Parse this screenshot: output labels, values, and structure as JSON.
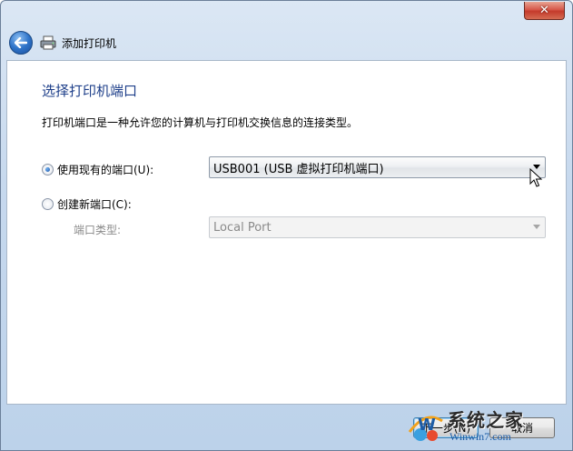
{
  "window": {
    "close_label": "✕"
  },
  "nav": {
    "title": "添加打印机"
  },
  "page": {
    "title": "选择打印机端口",
    "description": "打印机端口是一种允许您的计算机与打印机交换信息的连接类型。"
  },
  "options": {
    "existing_port": {
      "label": "使用现有的端口(U):",
      "checked": true,
      "selected_value": "USB001 (USB 虚拟打印机端口)"
    },
    "new_port": {
      "label": "创建新端口(C):",
      "checked": false,
      "type_label": "端口类型:",
      "type_value": "Local Port"
    }
  },
  "buttons": {
    "next": "下一步(N)",
    "cancel": "取消"
  },
  "watermark": {
    "main": "系统之家",
    "sub": "Winwin7.com",
    "logo_letter": "W"
  },
  "colors": {
    "title_blue": "#1e3f8a",
    "back_button": "#2f74c9",
    "close_button": "#c43a2b"
  }
}
